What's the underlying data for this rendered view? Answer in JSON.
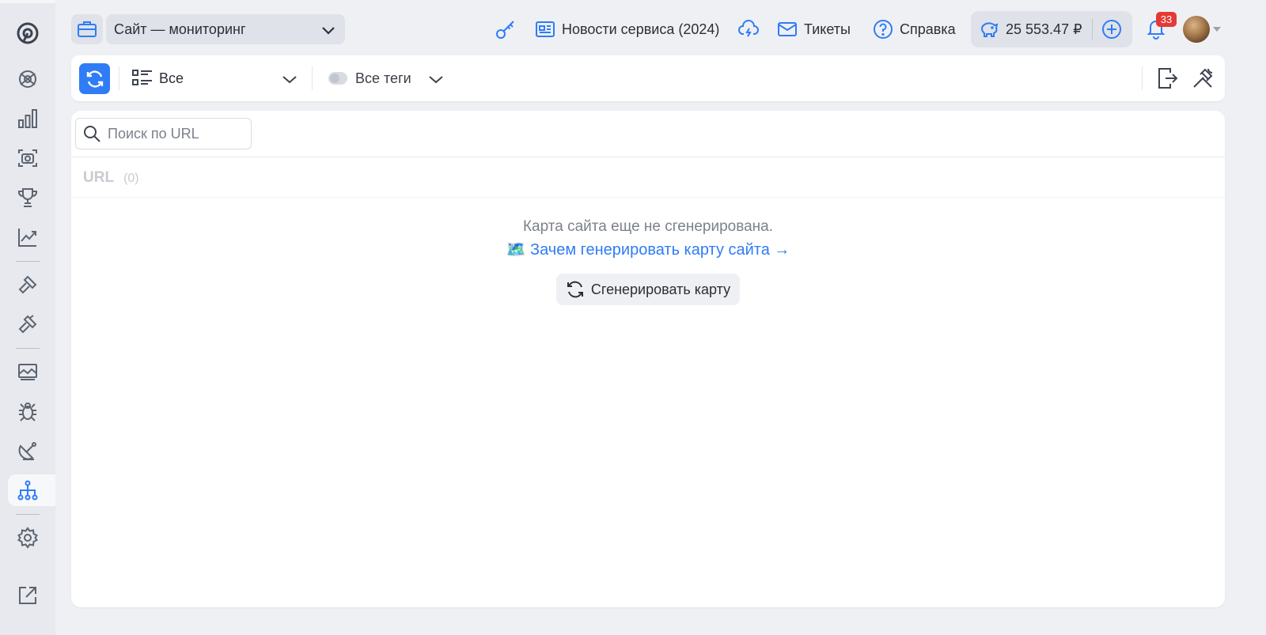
{
  "topbar": {
    "project_name": "Сайт — мониторинг",
    "news_label": "Новости сервиса (2024)",
    "tickets_label": "Тикеты",
    "help_label": "Справка",
    "balance": "25 553.47 ₽",
    "notifications_count": "33"
  },
  "toolbar": {
    "filter_label": "Все",
    "tags_label": "Все теги"
  },
  "main": {
    "search_placeholder": "Поиск по URL",
    "column_header": "URL",
    "column_count": "(0)",
    "empty_message": "Карта сайта еще не сгенерирована.",
    "why_link": "🗺️ Зачем генерировать карту сайта →",
    "generate_button": "Сгенерировать карту"
  },
  "colors": {
    "accent": "#2f7cf6",
    "badge": "#e53935",
    "sidebar_bg": "#e7e9ee",
    "icon": "#5c6470"
  },
  "sidebar": {
    "items": [
      "logo-icon",
      "tracking-icon",
      "bar-chart-icon",
      "camera-icon",
      "trophy-icon",
      "trend-icon",
      "hammer-icon",
      "hammer-alt-icon",
      "images-icon",
      "bug-icon",
      "satellite-icon",
      "sitemap-icon",
      "gear-icon",
      "external-link-icon"
    ],
    "active": "sitemap-icon"
  }
}
